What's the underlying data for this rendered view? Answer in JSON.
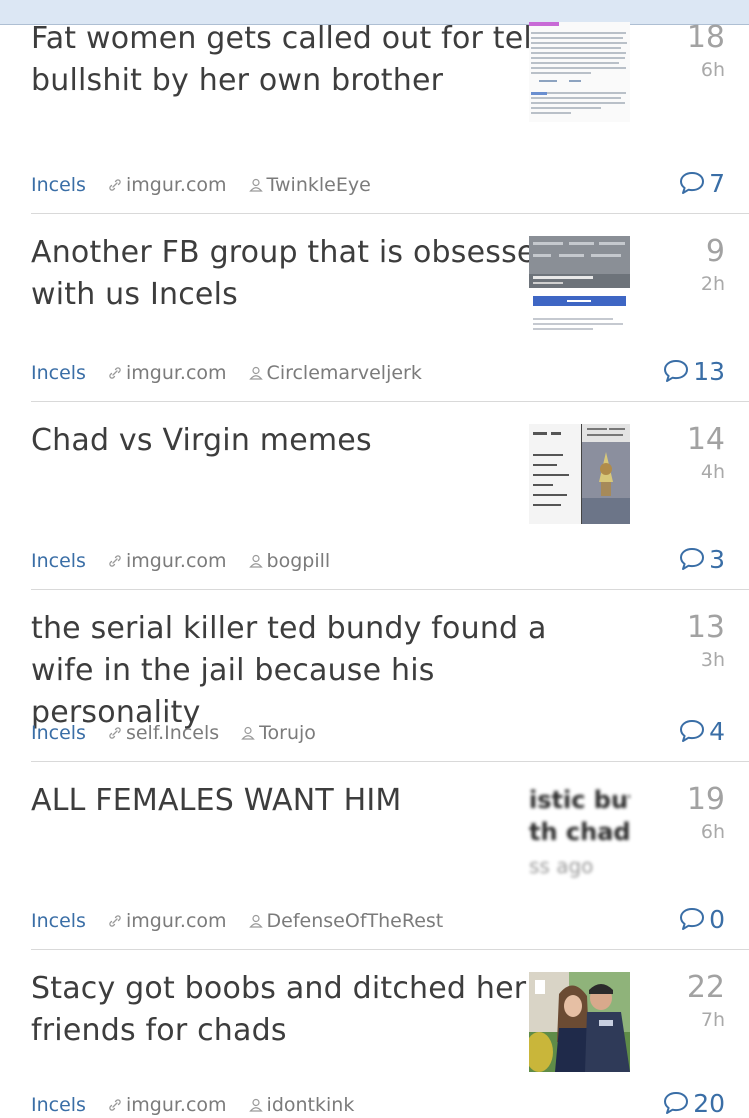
{
  "posts": [
    {
      "title": "Fat women gets called out for telling bullshit by her own brother",
      "subreddit": "Incels",
      "domain": "imgur.com",
      "author": "TwinkleEye",
      "score": "18",
      "age": "6h",
      "comments": "7",
      "thumb": "text-screenshot"
    },
    {
      "title": "Another FB group that is obsessed with us Incels",
      "subreddit": "Incels",
      "domain": "imgur.com",
      "author": "Circlemarveljerk",
      "score": "9",
      "age": "2h",
      "comments": "13",
      "thumb": "fb-group"
    },
    {
      "title": "Chad vs Virgin memes",
      "subreddit": "Incels",
      "domain": "imgur.com",
      "author": "bogpill",
      "score": "14",
      "age": "4h",
      "comments": "3",
      "thumb": "meme"
    },
    {
      "title": "the serial killer ted bundy found a wife in the jail because his personality",
      "subreddit": "Incels",
      "domain": "self.Incels",
      "author": "Torujo",
      "score": "13",
      "age": "3h",
      "comments": "4",
      "thumb": "none"
    },
    {
      "title": "ALL FEMALES WANT HIM",
      "subreddit": "Incels",
      "domain": "imgur.com",
      "author": "DefenseOfTheRest",
      "score": "19",
      "age": "6h",
      "comments": "0",
      "thumb": "blurred",
      "thumb_text": [
        "istic but",
        "th chads.",
        "ss ago"
      ]
    },
    {
      "title": "Stacy got boobs and ditched her incel friends for chads",
      "subreddit": "Incels",
      "domain": "imgur.com",
      "author": "idontkink",
      "score": "22",
      "age": "7h",
      "comments": "20",
      "thumb": "photo"
    }
  ],
  "colors": {
    "link": "#3a6ea6",
    "title": "#3d3d3d",
    "muted": "#7b7b7b",
    "score": "#a2a2a2"
  },
  "icons": {
    "domain": "link-icon",
    "author": "user-icon",
    "comments": "comment-bubble-icon"
  }
}
